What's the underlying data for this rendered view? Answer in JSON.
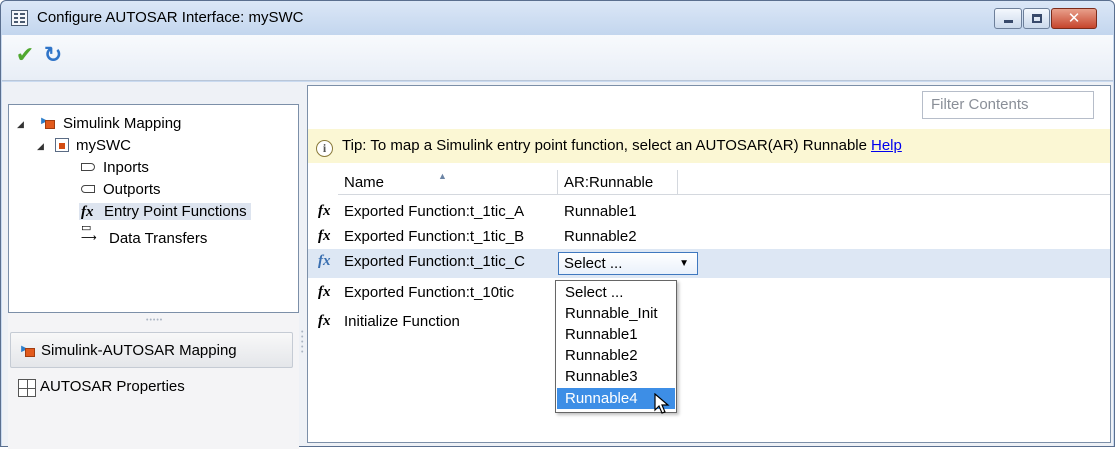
{
  "window": {
    "title": "Configure AUTOSAR Interface: mySWC",
    "close_glyph": "✕"
  },
  "toolbar": {
    "apply_icon": "checkmark-icon",
    "refresh_icon": "refresh-icon"
  },
  "tree": {
    "root": "Simulink Mapping",
    "model": "mySWC",
    "items": [
      {
        "label": "Inports",
        "icon": "inport-icon"
      },
      {
        "label": "Outports",
        "icon": "outport-icon"
      },
      {
        "label": "Entry Point Functions",
        "icon": "fx-icon",
        "selected": true
      },
      {
        "label": "Data Transfers",
        "icon": "data-transfer-icon"
      }
    ]
  },
  "nav": {
    "mapping": "Simulink-AUTOSAR Mapping",
    "properties": "AUTOSAR Properties"
  },
  "filter": {
    "placeholder": "Filter Contents"
  },
  "tip": {
    "text": "Tip: To map a Simulink entry point function, select an AUTOSAR(AR) Runnable",
    "help": "Help"
  },
  "table": {
    "columns": [
      "Name",
      "AR:Runnable"
    ],
    "rows": [
      {
        "name": "Exported Function:t_1tic_A",
        "runnable": "Runnable1"
      },
      {
        "name": "Exported Function:t_1tic_B",
        "runnable": "Runnable2"
      },
      {
        "name": "Exported Function:t_1tic_C",
        "runnable": "Select ...",
        "selected": true
      },
      {
        "name": "Exported Function:t_10tic",
        "runnable": ""
      },
      {
        "name": "Initialize Function",
        "runnable": ""
      }
    ]
  },
  "dropdown": {
    "options": [
      "Select ...",
      "Runnable_Init",
      "Runnable1",
      "Runnable2",
      "Runnable3",
      "Runnable4"
    ],
    "highlighted": "Runnable4"
  },
  "colors": {
    "title_bg": "#c9daf0",
    "tip_bg": "#fbf7d4",
    "highlight": "#3d8ee6"
  }
}
